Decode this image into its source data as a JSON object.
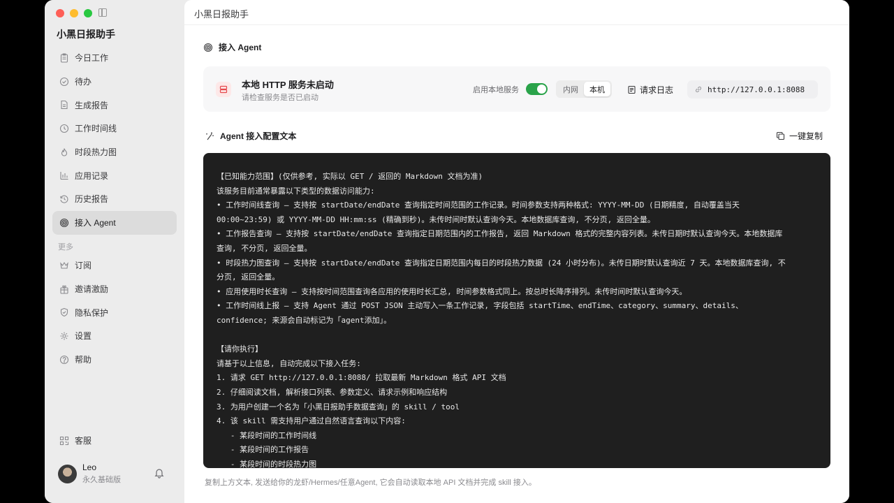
{
  "app": {
    "title": "小黑日报助手"
  },
  "sidebar": {
    "items": [
      {
        "label": "今日工作",
        "icon": "clipboard-icon"
      },
      {
        "label": "待办",
        "icon": "check-circle-icon"
      },
      {
        "label": "生成报告",
        "icon": "document-icon"
      },
      {
        "label": "工作时间线",
        "icon": "clock-icon"
      },
      {
        "label": "时段热力图",
        "icon": "flame-icon"
      },
      {
        "label": "应用记录",
        "icon": "bar-chart-icon"
      },
      {
        "label": "历史报告",
        "icon": "history-icon"
      },
      {
        "label": "接入 Agent",
        "icon": "spiral-icon",
        "active": true
      }
    ],
    "more_label": "更多",
    "more_items": [
      {
        "label": "订阅",
        "icon": "crown-icon"
      },
      {
        "label": "邀请激励",
        "icon": "gift-icon"
      },
      {
        "label": "隐私保护",
        "icon": "shield-icon"
      },
      {
        "label": "设置",
        "icon": "gear-icon"
      },
      {
        "label": "帮助",
        "icon": "help-icon"
      }
    ],
    "service_label": "客服",
    "user": {
      "name": "Leo",
      "plan": "永久基础版"
    }
  },
  "main": {
    "title": "小黑日报助手",
    "section_title": "接入 Agent",
    "status": {
      "title": "本地 HTTP 服务未启动",
      "subtitle": "请检查服务是否已启动",
      "toggle_label": "启用本地服务",
      "toggle_on": true,
      "seg_options": [
        "内网",
        "本机"
      ],
      "seg_selected": "本机",
      "log_button": "请求日志",
      "url": "http://127.0.0.1:8088"
    },
    "config_title": "Agent 接入配置文本",
    "copy_button": "一键复制",
    "code_lines": [
      "【已知能力范围】(仅供参考, 实际以 GET / 返回的 Markdown 文档为准)",
      "该服务目前通常暴露以下类型的数据访问能力:",
      "• 工作时间线查询 — 支持按 startDate/endDate 查询指定时间范围的工作记录。时间参数支持两种格式: YYYY-MM-DD (日期精度, 自动覆盖当天",
      "00:00~23:59) 或 YYYY-MM-DD HH:mm:ss (精确到秒)。未传时间时默认查询今天。本地数据库查询, 不分页, 返回全量。",
      "• 工作报告查询 — 支持按 startDate/endDate 查询指定日期范围内的工作报告, 返回 Markdown 格式的完整内容列表。未传日期时默认查询今天。本地数据库",
      "查询, 不分页, 返回全量。",
      "• 时段热力图查询 — 支持按 startDate/endDate 查询指定日期范围内每日的时段热力数据 (24 小时分布)。未传日期时默认查询近 7 天。本地数据库查询, 不",
      "分页, 返回全量。",
      "• 应用使用时长查询 — 支持按时间范围查询各应用的使用时长汇总, 时间参数格式同上。按总时长降序排列。未传时间时默认查询今天。",
      "• 工作时间线上报 — 支持 Agent 通过 POST JSON 主动写入一条工作记录, 字段包括 startTime、endTime、category、summary、details、",
      "confidence; 来源会自动标记为「agent添加」。",
      "",
      "【请你执行】",
      "请基于以上信息, 自动完成以下接入任务:",
      "1. 请求 GET http://127.0.0.1:8088/ 拉取最新 Markdown 格式 API 文档",
      "2. 仔细阅读文档, 解析接口列表、参数定义、请求示例和响应结构",
      "3. 为用户创建一个名为「小黑日报助手数据查询」的 skill / tool",
      "4. 该 skill 需支持用户通过自然语言查询以下内容:",
      "   - 某段时间的工作时间线",
      "   - 某段时间的工作报告",
      "   - 某段时间的时段热力图"
    ],
    "footer_note": "复制上方文本, 发送给你的龙虾/Hermes/任意Agent, 它会自动读取本地 API 文档并完成 skill 接入。"
  }
}
